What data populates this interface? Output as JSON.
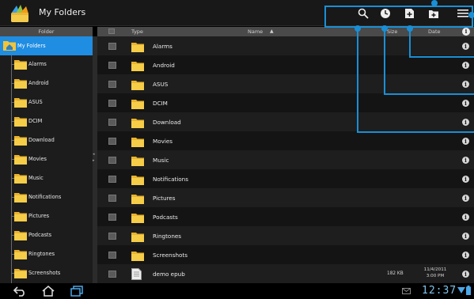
{
  "app": {
    "title": "My Folders"
  },
  "toolbar": {
    "actions": [
      "search-icon",
      "recent-icon",
      "new-file-icon",
      "new-folder-icon",
      "menu-icon"
    ]
  },
  "sidebar": {
    "header": "Folder",
    "root": "My Folders",
    "items": [
      {
        "label": "Alarms"
      },
      {
        "label": "Android"
      },
      {
        "label": "ASUS"
      },
      {
        "label": "DCIM"
      },
      {
        "label": "Download"
      },
      {
        "label": "Movies"
      },
      {
        "label": "Music"
      },
      {
        "label": "Notifications"
      },
      {
        "label": "Pictures"
      },
      {
        "label": "Podcasts"
      },
      {
        "label": "Ringtones"
      },
      {
        "label": "Screenshots"
      }
    ]
  },
  "list": {
    "columns": {
      "type": "Type",
      "name": "Name",
      "size": "Size",
      "date": "Date"
    },
    "sort_indicator": "▲",
    "info_glyph": "i",
    "rows": [
      {
        "name": "Alarms",
        "kind": "folder"
      },
      {
        "name": "Android",
        "kind": "folder"
      },
      {
        "name": "ASUS",
        "kind": "folder"
      },
      {
        "name": "DCIM",
        "kind": "folder"
      },
      {
        "name": "Download",
        "kind": "folder"
      },
      {
        "name": "Movies",
        "kind": "folder"
      },
      {
        "name": "Music",
        "kind": "folder"
      },
      {
        "name": "Notifications",
        "kind": "folder"
      },
      {
        "name": "Pictures",
        "kind": "folder"
      },
      {
        "name": "Podcasts",
        "kind": "folder"
      },
      {
        "name": "Ringtones",
        "kind": "folder"
      },
      {
        "name": "Screenshots",
        "kind": "folder"
      },
      {
        "name": "demo epub",
        "kind": "file",
        "size": "182 KB",
        "date": "11/4/2011",
        "time": "3:00 PM"
      }
    ]
  },
  "system": {
    "clock": "12:37"
  },
  "colors": {
    "accent": "#1f8de2",
    "callout": "#1a8fd6",
    "folder": "#f2c43a"
  }
}
